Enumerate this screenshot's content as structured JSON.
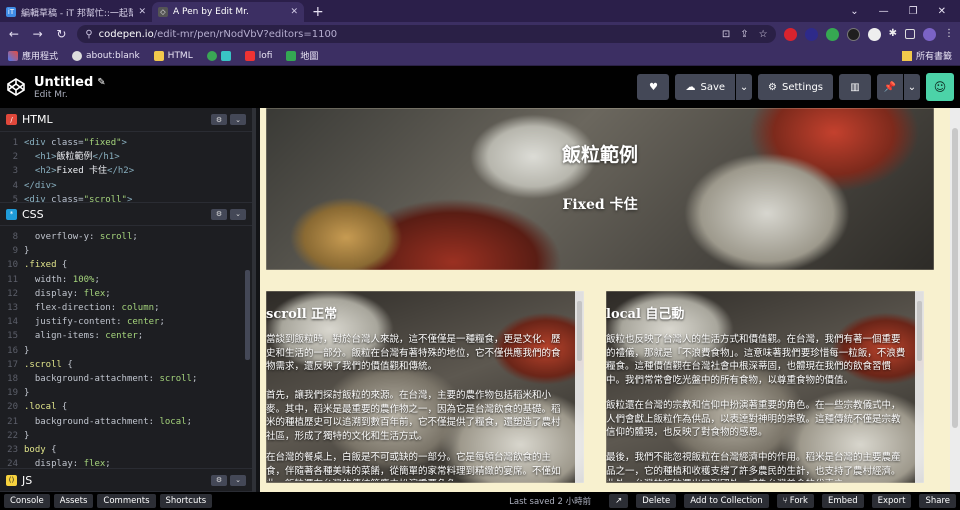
{
  "browser": {
    "tabs": [
      {
        "title": "編輯草稿 - iT 邦幫忙::一起幫忙解",
        "favicon": "iT",
        "active": false
      },
      {
        "title": "A Pen by Edit Mr.",
        "favicon": "A",
        "active": true
      }
    ],
    "url_host": "codepen.io",
    "url_path": "/edit-mr/pen/rNodVbV?editors=1100",
    "bookmarks": [
      "應用程式",
      "about:blank",
      "HTML",
      "lofi",
      "地圖"
    ],
    "bookmarks_right": "所有書籤"
  },
  "codepen": {
    "pen_title": "Untitled",
    "author": "Edit Mr.",
    "save_label": "Save",
    "settings_label": "Settings"
  },
  "editors": {
    "html_label": "HTML",
    "css_label": "CSS",
    "js_label": "JS",
    "html_lines": [
      {
        "n": "1",
        "parts": [
          [
            "tag",
            "<div "
          ],
          [
            "attr",
            "class="
          ],
          [
            "str",
            "\"fixed\""
          ],
          [
            "tag",
            ">"
          ]
        ]
      },
      {
        "n": "2",
        "parts": [
          [
            "txt",
            "  "
          ],
          [
            "tag",
            "<h1>"
          ],
          [
            "txt",
            "飯粒範例"
          ],
          [
            "tag",
            "</h1>"
          ]
        ]
      },
      {
        "n": "3",
        "parts": [
          [
            "txt",
            "  "
          ],
          [
            "tag",
            "<h2>"
          ],
          [
            "txt",
            "Fixed 卡住"
          ],
          [
            "tag",
            "</h2>"
          ]
        ]
      },
      {
        "n": "4",
        "parts": [
          [
            "tag",
            "</div>"
          ]
        ]
      },
      {
        "n": "5",
        "parts": [
          [
            "tag",
            "<div "
          ],
          [
            "attr",
            "class="
          ],
          [
            "str",
            "\"scroll\""
          ],
          [
            "tag",
            ">"
          ]
        ]
      }
    ],
    "css_lines": [
      {
        "n": "8",
        "parts": [
          [
            "prop",
            "  overflow-y: "
          ],
          [
            "val",
            "scroll"
          ],
          [
            "prop",
            ";"
          ]
        ]
      },
      {
        "n": "9",
        "parts": [
          [
            "prop",
            "}"
          ]
        ]
      },
      {
        "n": "10",
        "parts": [
          [
            "sel",
            ".fixed"
          ],
          [
            "prop",
            " {"
          ]
        ]
      },
      {
        "n": "11",
        "parts": [
          [
            "prop",
            "  width: "
          ],
          [
            "val",
            "100%"
          ],
          [
            "prop",
            ";"
          ]
        ]
      },
      {
        "n": "12",
        "parts": [
          [
            "prop",
            "  display: "
          ],
          [
            "val",
            "flex"
          ],
          [
            "prop",
            ";"
          ]
        ]
      },
      {
        "n": "13",
        "parts": [
          [
            "prop",
            "  flex-direction: "
          ],
          [
            "val",
            "column"
          ],
          [
            "prop",
            ";"
          ]
        ]
      },
      {
        "n": "14",
        "parts": [
          [
            "prop",
            "  justify-content: "
          ],
          [
            "val",
            "center"
          ],
          [
            "prop",
            ";"
          ]
        ]
      },
      {
        "n": "15",
        "parts": [
          [
            "prop",
            "  align-items: "
          ],
          [
            "val",
            "center"
          ],
          [
            "prop",
            ";"
          ]
        ]
      },
      {
        "n": "16",
        "parts": [
          [
            "prop",
            "}"
          ]
        ]
      },
      {
        "n": "17",
        "parts": [
          [
            "sel",
            ".scroll"
          ],
          [
            "prop",
            " {"
          ]
        ]
      },
      {
        "n": "18",
        "parts": [
          [
            "prop",
            "  background-attachment: "
          ],
          [
            "val",
            "scroll"
          ],
          [
            "prop",
            ";"
          ]
        ]
      },
      {
        "n": "19",
        "parts": [
          [
            "prop",
            "}"
          ]
        ]
      },
      {
        "n": "20",
        "parts": [
          [
            "sel",
            ".local"
          ],
          [
            "prop",
            " {"
          ]
        ]
      },
      {
        "n": "21",
        "parts": [
          [
            "prop",
            "  background-attachment: "
          ],
          [
            "val",
            "local"
          ],
          [
            "prop",
            ";"
          ]
        ]
      },
      {
        "n": "22",
        "parts": [
          [
            "prop",
            "}"
          ]
        ]
      },
      {
        "n": "23",
        "parts": [
          [
            "sel",
            "body"
          ],
          [
            "prop",
            " {"
          ]
        ]
      },
      {
        "n": "24",
        "parts": [
          [
            "prop",
            "  display: "
          ],
          [
            "val",
            "flex"
          ],
          [
            "prop",
            ";"
          ]
        ]
      }
    ]
  },
  "preview": {
    "h1": "飯粒範例",
    "h2": "Fixed 卡住",
    "scroll_card": {
      "title": "scroll 正常",
      "p1": "當談到飯粒時，對於台灣人來說，這不僅僅是一種糧食，更是文化、歷史和生活的一部分。飯粒在台灣有著特殊的地位，它不僅供應我們的食物需求，還反映了我們的價值觀和傳統。",
      "p2": "首先，讓我們探討飯粒的來源。在台灣，主要的農作物包括稻米和小麥。其中，稻米是最重要的農作物之一，因為它是台灣飲食的基礎。稻米的種植歷史可以追溯到數百年前，它不僅提供了糧食，還塑造了農村社區，形成了獨特的文化和生活方式。",
      "p3": "在台灣的餐桌上，白飯是不可或缺的一部分。它是每頓台灣飲食的主食，伴隨著各種美味的菜餚，從簡單的家常料理到精緻的宴席。不僅如此，飯粒還在台灣的傳統節慶中扮演重要角色。"
    },
    "local_card": {
      "title": "local 自己動",
      "p1": "飯粒也反映了台灣人的生活方式和價值觀。在台灣，我們有著一個重要的禮儀，那就是「不浪費食物」。這意味著我們要珍惜每一粒飯，不浪費糧食。這種價值觀在台灣社會中根深蒂固，也體現在我們的飲食習慣中。我們常常會吃光盤中的所有食物，以尊重食物的價值。",
      "p2": "飯粒還在台灣的宗教和信仰中扮演著重要的角色。在一些宗教儀式中，人們會獻上飯粒作為供品，以表達對神明的崇敬。這種傳統不僅是宗教信仰的體現，也反映了對食物的感恩。",
      "p3": "最後，我們不能忽視飯粒在台灣經濟中的作用。稻米是台灣的主要農產品之一，它的種植和收穫支撐了許多農民的生計，也支持了農村經濟。此外，台灣的飯粒還出口到國外，成為台灣美食的代表之一。"
    }
  },
  "footer": {
    "left_buttons": [
      "Console",
      "Assets",
      "Comments",
      "Shortcuts"
    ],
    "saved": "Last saved 2 小時前",
    "right_buttons": [
      "Delete",
      "Add to Collection",
      "Fork",
      "Embed",
      "Export",
      "Share"
    ]
  }
}
